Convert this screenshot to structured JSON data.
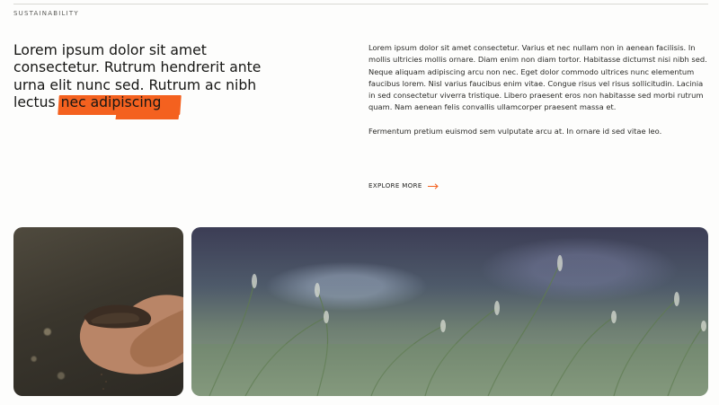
{
  "section": {
    "label": "SUSTAINABILITY"
  },
  "headline": {
    "lead": "Lorem ipsum dolor sit amet consectetur. Rutrum hendrerit ante urna elit nunc sed. Rutrum ac nibh lectus ",
    "highlight": "nec adipiscing"
  },
  "body": {
    "paragraphs": [
      "Lorem ipsum dolor sit amet consectetur. Varius et nec nullam non in aenean facilisis. In mollis ultricies mollis ornare. Diam enim non diam tortor. Habitasse dictumst nisi nibh sed. Neque aliquam adipiscing arcu non nec. Eget dolor commodo ultrices nunc elementum faucibus lorem. Nisl varius faucibus enim vitae. Congue risus vel risus sollicitudin. Lacinia in sed consectetur viverra tristique. Libero praesent eros non habitasse sed morbi rutrum quam. Nam aenean felis convallis ullamcorper praesent massa et.",
      "Fermentum pretium euismod sem vulputate arcu at. In ornare id sed vitae leo."
    ]
  },
  "cta": {
    "label": "EXPLORE MORE",
    "icon": "arrow-right-icon"
  },
  "colors": {
    "accent": "#f4611f",
    "background": "#fdfdfc",
    "text": "#1d1d1b"
  },
  "images": {
    "soil": "photo-hands-holding-soil",
    "grass": "photo-wild-grass-field"
  }
}
